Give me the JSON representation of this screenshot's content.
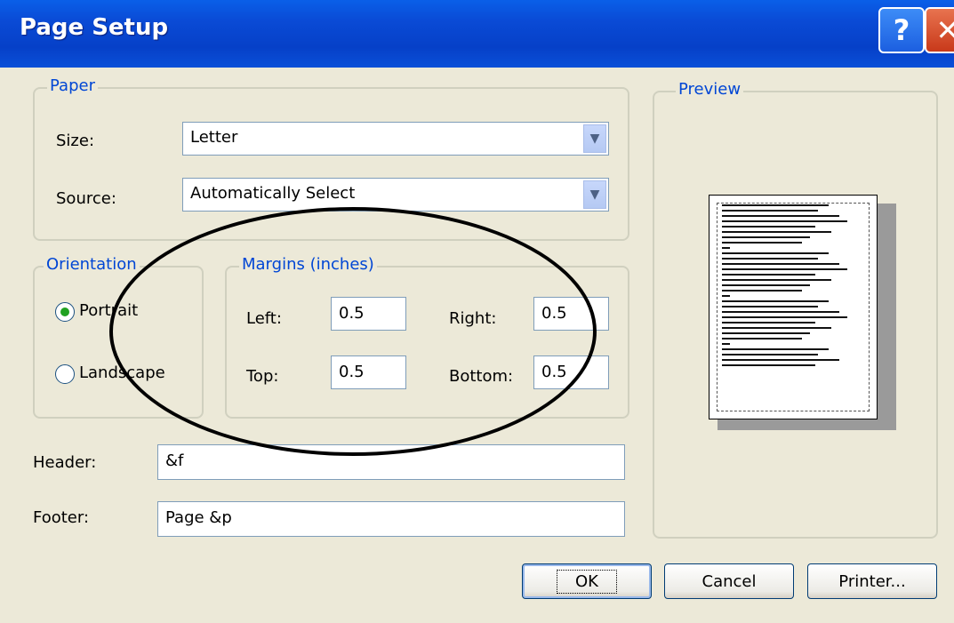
{
  "window": {
    "title": "Page Setup",
    "help_glyph": "?",
    "close_glyph": "✕"
  },
  "paper": {
    "legend": "Paper",
    "size_label": "Size:",
    "size_value": "Letter",
    "source_label": "Source:",
    "source_value": "Automatically Select"
  },
  "orientation": {
    "legend": "Orientation",
    "portrait_label": "Portrait",
    "landscape_label": "Landscape",
    "selected": "Portrait"
  },
  "margins": {
    "legend": "Margins (inches)",
    "left_label": "Left:",
    "left_value": "0.5",
    "right_label": "Right:",
    "right_value": "0.5",
    "top_label": "Top:",
    "top_value": "0.5",
    "bottom_label": "Bottom:",
    "bottom_value": "0.5"
  },
  "header": {
    "label": "Header:",
    "value": "&f"
  },
  "footer": {
    "label": "Footer:",
    "value": "Page &p"
  },
  "preview": {
    "legend": "Preview"
  },
  "buttons": {
    "ok": "OK",
    "cancel": "Cancel",
    "printer": "Printer..."
  },
  "icons": {
    "dropdown": "chevron-down-icon",
    "help": "help-icon",
    "close": "close-icon"
  },
  "colors": {
    "titlebar": "#0a4bd6",
    "legend": "#0046d5",
    "dialog_bg": "#ece9d8",
    "radio_dot": "#21a121"
  }
}
